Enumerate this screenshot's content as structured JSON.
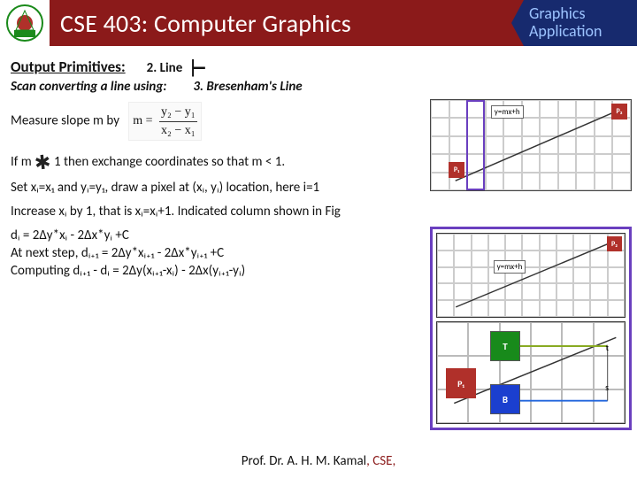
{
  "header": {
    "course_title": "CSE 403: Computer Graphics",
    "tag_line1": "Graphics",
    "tag_line2": "Application"
  },
  "section": {
    "heading": "Output Primitives:",
    "subhead": "2. Line",
    "scan_line": "Scan converting a line using:",
    "algo": "3. Bresenham's Line"
  },
  "body": {
    "measure_label": "Measure slope m by",
    "m_eq_label": "m =",
    "frac_num": "y₂ − y₁",
    "frac_den": "x₂ − x₁",
    "if_m_prefix": "If m",
    "if_m_suffix": " 1  then exchange coordinates so that m < 1.",
    "hand_mark": "✱",
    "set_xy": "Set xᵢ=x₁ and yᵢ=y₁, draw a pixel at (xᵢ, yᵢ) location, here i=1",
    "increase": "Increase xᵢ by 1, that is xᵢ=xᵢ+1. Indicated column shown in Fig",
    "d1": "dᵢ = 2Δy*xᵢ - 2Δx*yᵢ +C",
    "d2": "At next step, dᵢ₊₁ = 2Δy*xᵢ₊₁ - 2Δx*yᵢ₊₁ +C",
    "d3": "Computing dᵢ₊₁ - dᵢ  = 2Δy(xᵢ₊₁-xᵢ) - 2Δx(yᵢ₊₁-yᵢ)"
  },
  "figures": {
    "eq_label": "y=mx+h",
    "p1": "P₁",
    "p2": "P₂",
    "T": "T",
    "B": "B",
    "s": "s",
    "t": "t"
  },
  "footer": {
    "text_black": "Prof. Dr. A. H. M. Kamal",
    "text_red": ", CSE,"
  }
}
